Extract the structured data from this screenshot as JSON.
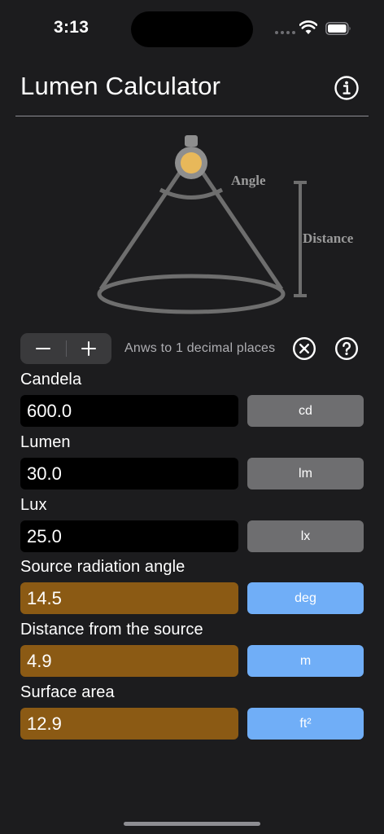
{
  "status": {
    "time": "3:13"
  },
  "header": {
    "title": "Lumen Calculator"
  },
  "illustration": {
    "angle_label": "Angle",
    "distance_label": "Distance"
  },
  "toolbar": {
    "decrement": "−",
    "increment": "+",
    "precision_text": "Anws to 1 decimal places"
  },
  "fields": [
    {
      "label": "Candela",
      "value": "600.0",
      "unit": "cd"
    },
    {
      "label": "Lumen",
      "value": "30.0",
      "unit": "lm"
    },
    {
      "label": "Lux",
      "value": "25.0",
      "unit": "lx"
    },
    {
      "label": "Source radiation angle",
      "value": "14.5",
      "unit": "deg"
    },
    {
      "label": "Distance from the source",
      "value": "4.9",
      "unit": "m"
    },
    {
      "label": "Surface area",
      "value": "12.9",
      "unit": "ft²"
    }
  ],
  "colors": {
    "background": "#1c1c1e",
    "output_field": "#000000",
    "input_field": "#8b5a14",
    "output_unit": "#6e6e70",
    "input_unit": "#70aef7",
    "lamp": "#e8b85a"
  }
}
